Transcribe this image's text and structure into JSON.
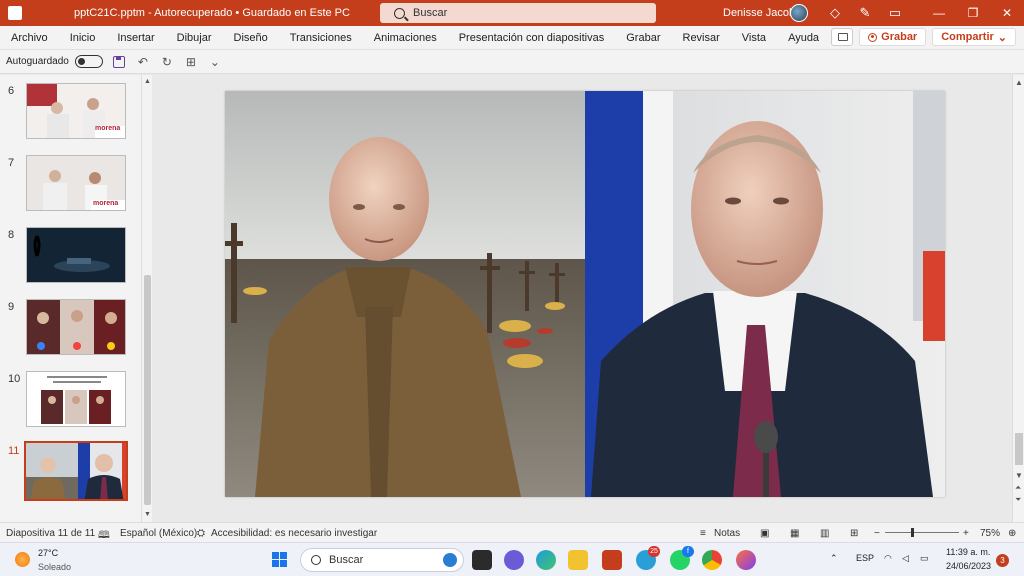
{
  "titlebar": {
    "title": "pptC21C.pptm  -  Autorecuperado  •  Guardado en Este PC",
    "search_placeholder": "Buscar",
    "user": "Denisse Jacobo"
  },
  "ribbon": {
    "tabs": [
      "Archivo",
      "Inicio",
      "Insertar",
      "Dibujar",
      "Diseño",
      "Transiciones",
      "Animaciones",
      "Presentación con diapositivas",
      "Grabar",
      "Revisar",
      "Vista",
      "Ayuda"
    ],
    "record_label": "Grabar",
    "share_label": "Compartir"
  },
  "qat": {
    "autosave_label": "Autoguardado"
  },
  "thumbnails": [
    {
      "number": "6",
      "caption": "morena"
    },
    {
      "number": "7",
      "caption": "morena"
    },
    {
      "number": "8"
    },
    {
      "number": "9"
    },
    {
      "number": "10"
    },
    {
      "number": "11"
    }
  ],
  "statusbar": {
    "slide_info": "Diapositiva 11 de 11",
    "language": "Español (México)",
    "accessibility": "Accesibilidad: es necesario investigar",
    "notes_label": "Notas",
    "zoom": "75%"
  },
  "taskbar": {
    "temperature": "27°C",
    "condition": "Soleado",
    "search_label": "Buscar",
    "language": "ESP",
    "time": "11:39 a. m.",
    "date": "24/06/2023",
    "notification_count": "3",
    "telegram_badge": "25",
    "facebook_badge": "f"
  },
  "colors": {
    "accent": "#c43e1c",
    "ribbon_bg": "#f3f3f3",
    "taskbar_bg": "#eef2f8"
  }
}
